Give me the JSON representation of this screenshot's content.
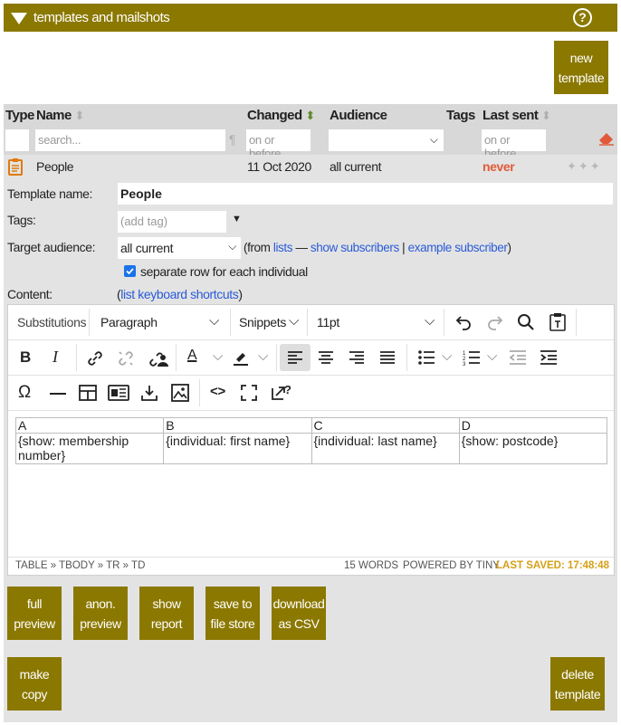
{
  "header": {
    "title": "templates and mailshots",
    "help": "?"
  },
  "new_template": {
    "line1": "new",
    "line2": "template"
  },
  "columns": {
    "type": "Type",
    "name": "Name",
    "changed": "Changed",
    "audience": "Audience",
    "tags": "Tags",
    "last_sent": "Last sent",
    "sort_icon": "⬍"
  },
  "filters": {
    "name_placeholder": "search...",
    "changed_placeholder": "on or before.",
    "lastsent_placeholder": "on or before."
  },
  "row": {
    "name": "People",
    "changed": "11 Oct 2020",
    "audience": "all current",
    "last_sent": "never"
  },
  "form": {
    "template_name_label": "Template name:",
    "template_name_value": "People",
    "tags_label": "Tags:",
    "tags_placeholder": "(add tag)",
    "target_label": "Target audience:",
    "target_value": "all current",
    "from_open": "(from ",
    "lists": "lists",
    "dash": " — ",
    "show_subscribers": "show subscribers",
    "pipe": " | ",
    "example_subscriber": "example subscriber",
    "close": ")",
    "separate_row": "separate row for each individual",
    "content_label": "Content:",
    "shortcuts_open": "(",
    "shortcuts_link": "list keyboard shortcuts",
    "shortcuts_close": ")"
  },
  "toolbar": {
    "substitutions": "Substitutions",
    "paragraph": "Paragraph",
    "snippets": "Snippets",
    "fontsize": "11pt"
  },
  "doc_table": {
    "headers": [
      "A",
      "B",
      "C",
      "D"
    ],
    "cells": [
      "{show: membership number}",
      "{individual: first name}",
      "{individual: last name}",
      "{show: postcode}"
    ]
  },
  "status": {
    "path": "TABLE » TBODY » TR » TD",
    "words": "15 WORDS",
    "powered": "POWERED BY TINY",
    "saved": "LAST SAVED: 17:48:48"
  },
  "actions": {
    "full_preview": [
      "full",
      "preview"
    ],
    "anon_preview": [
      "anon.",
      "preview"
    ],
    "show_report": [
      "show",
      "report"
    ],
    "save_store": [
      "save to",
      "file store"
    ],
    "download_csv": [
      "download",
      "as CSV"
    ],
    "make_copy": [
      "make",
      "copy"
    ],
    "delete_template": [
      "delete",
      "template"
    ]
  },
  "colors": {
    "olive": "#8b7800",
    "never": "#e05a3a",
    "saved": "#d4a017",
    "link": "#2a5bd7"
  }
}
